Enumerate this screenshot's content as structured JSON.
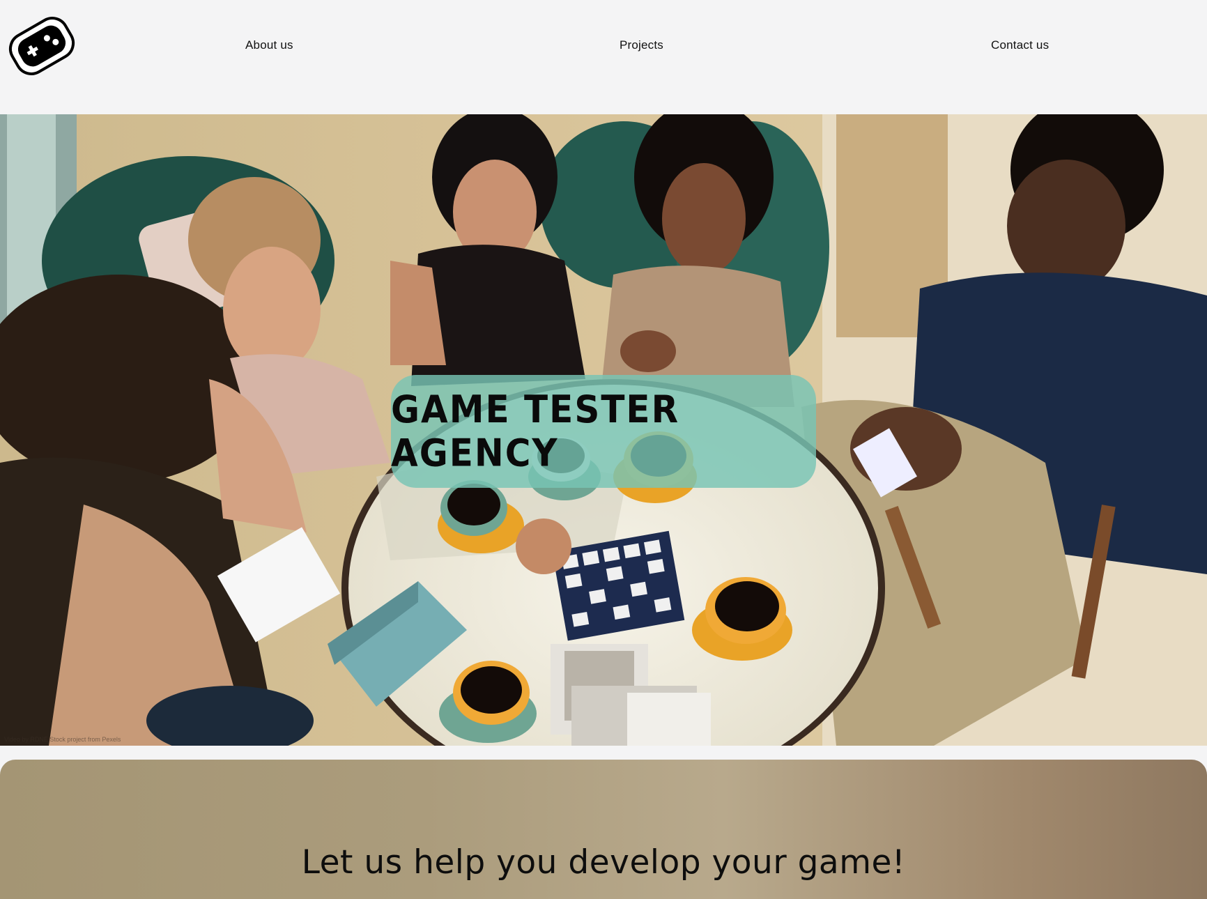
{
  "header": {
    "logo_icon": "gamepad-icon",
    "nav": [
      {
        "label": "About us"
      },
      {
        "label": "Projects"
      },
      {
        "label": "Contact us"
      }
    ]
  },
  "hero": {
    "title": "Game Tester Agency",
    "video_credit": "Video by RDNE Stock project from Pexels",
    "background_scene": "people-playing-board-game-photo"
  },
  "section_help": {
    "heading": "Let us help you develop your game!"
  },
  "colors": {
    "page_background": "#f4f4f5",
    "title_box": "#78c4b4",
    "section_background": "#a49574"
  }
}
